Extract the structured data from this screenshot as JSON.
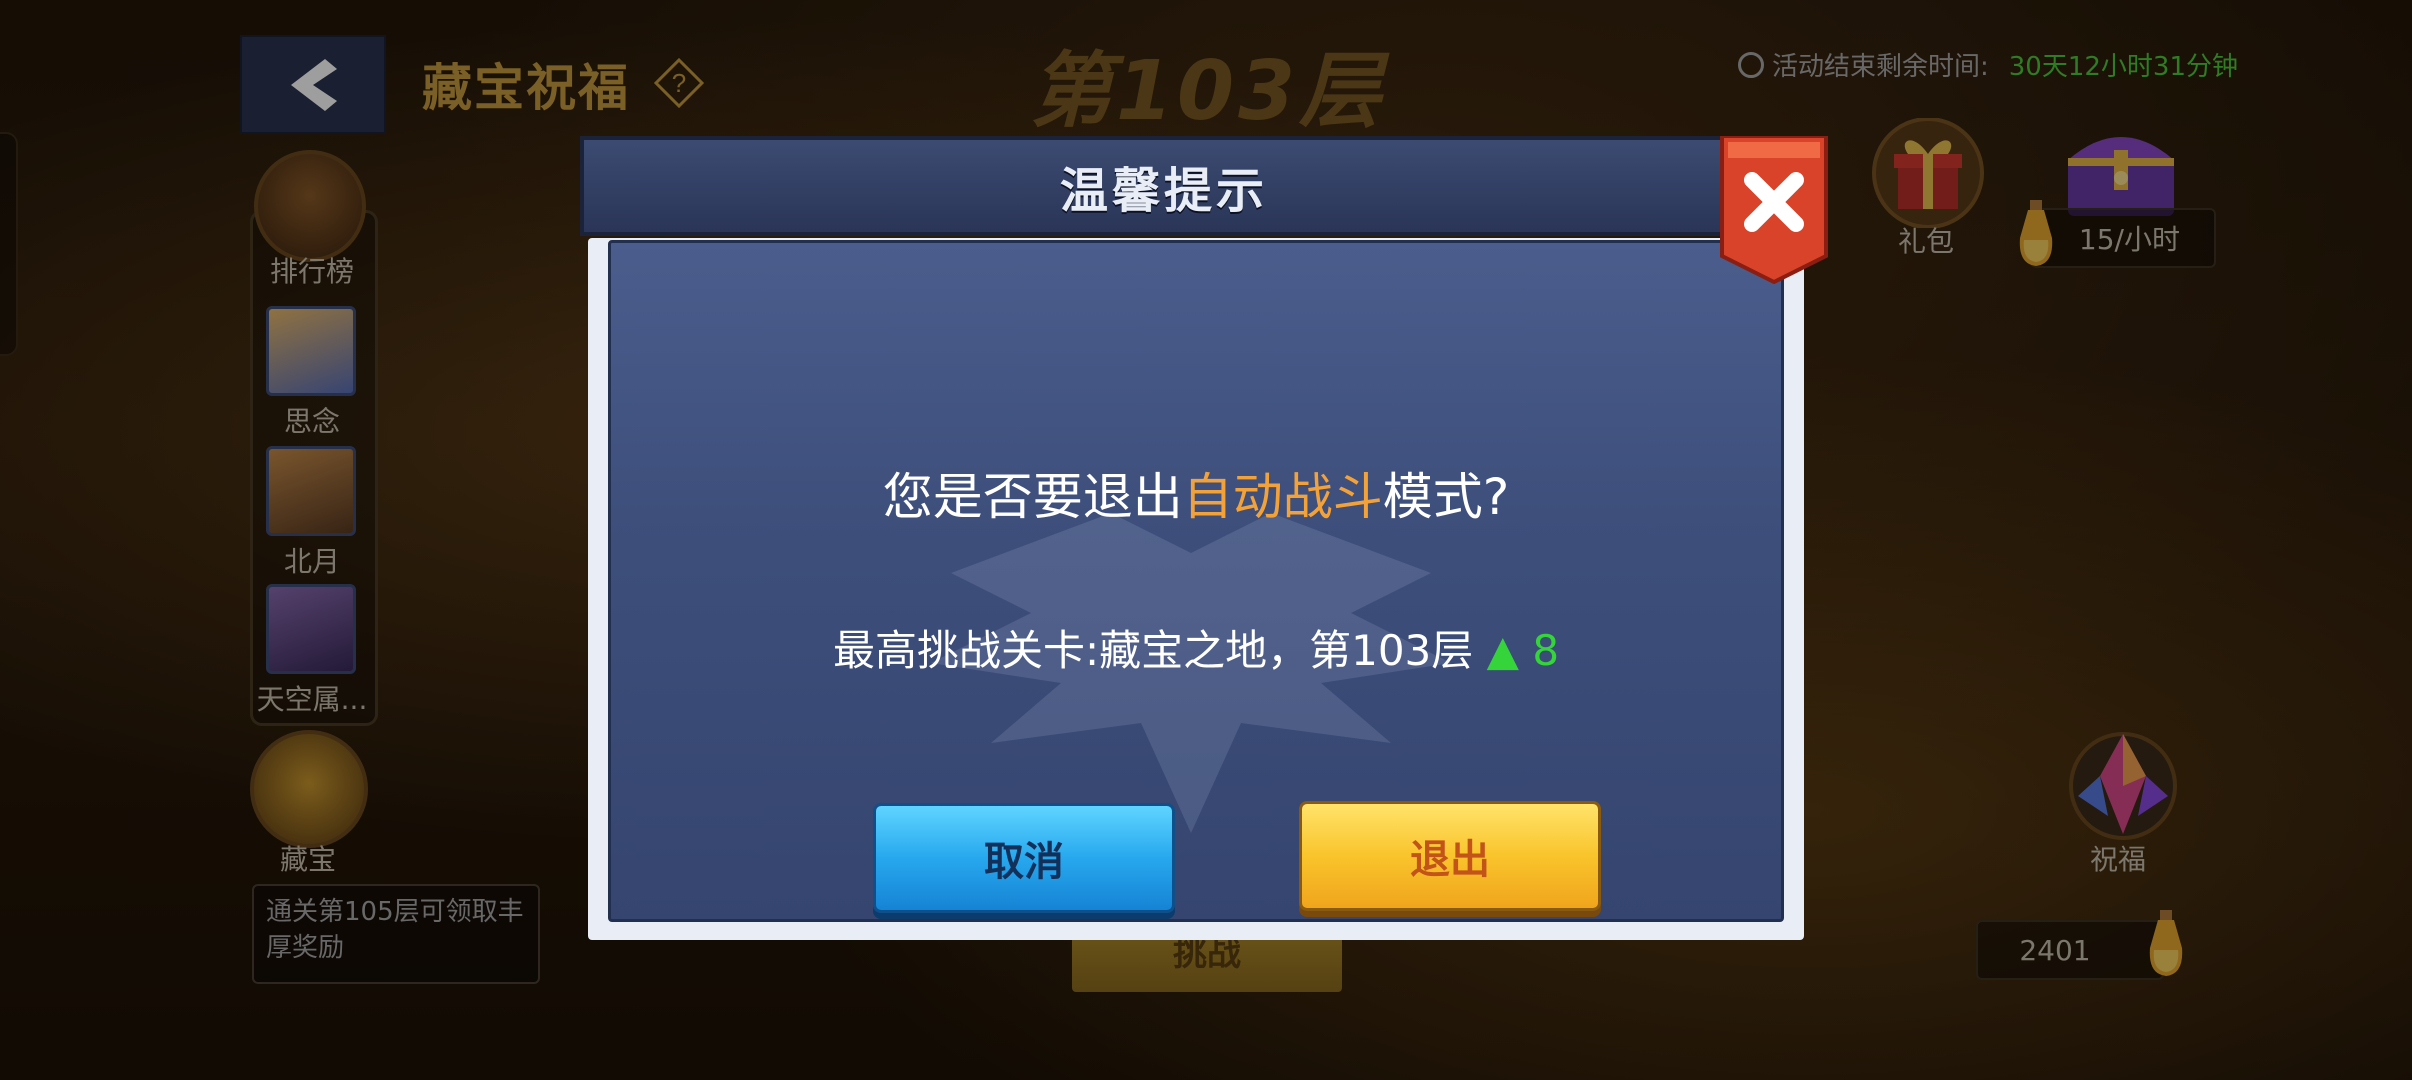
{
  "header": {
    "title": "藏宝祝福",
    "floor_title": "第103层",
    "timer_label": "活动结束剩余时间:",
    "timer_value": "30天12小时31分钟"
  },
  "sidebar": {
    "items": [
      {
        "label": "排行榜"
      },
      {
        "label": "思念"
      },
      {
        "label": "北月"
      },
      {
        "label": "天空属..."
      }
    ],
    "treasure_label": "藏宝",
    "tip": "通关第105层可领取丰厚奖励"
  },
  "right": {
    "gift_label": "礼包",
    "rate": "15/小时",
    "bless_label": "祝福",
    "count": "2401"
  },
  "challenge_button": "挑战",
  "modal": {
    "title": "温馨提示",
    "question_prefix": "您是否要退出",
    "question_highlight": "自动战斗",
    "question_suffix": "模式?",
    "record_text": "最高挑战关卡:藏宝之地，第103层",
    "record_up_value": "8",
    "cancel_label": "取消",
    "exit_label": "退出"
  },
  "colors": {
    "highlight": "#f3a23a",
    "up": "#35d43a",
    "timer_value": "#4cc83a"
  }
}
